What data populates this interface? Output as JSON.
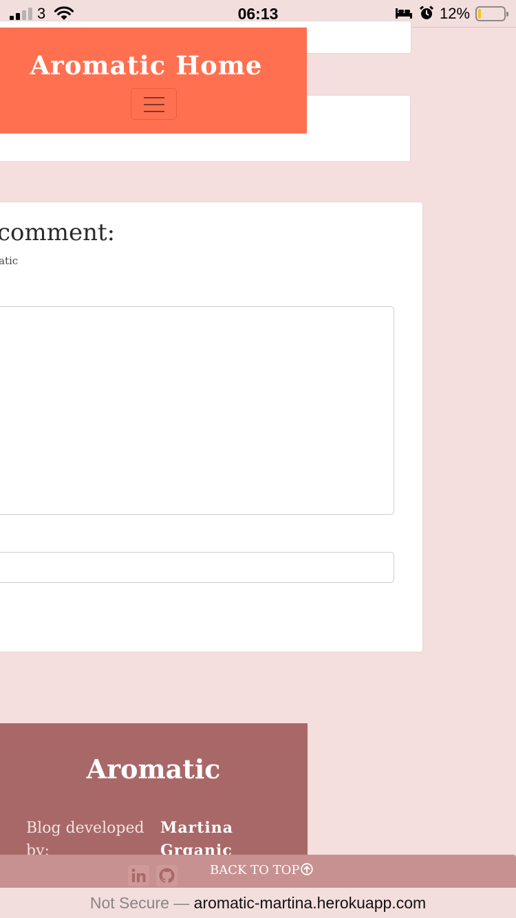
{
  "status_bar": {
    "carrier": "3",
    "time": "06:13",
    "battery_percent": "12%",
    "battery_level": 0.12,
    "icons": [
      "signal-icon",
      "wifi-icon",
      "bed-icon",
      "alarm-icon",
      "battery-icon"
    ]
  },
  "navbar": {
    "brand": "Aromatic Home",
    "background_color": "#ff7051",
    "toggler_icon": "hamburger-icon"
  },
  "comment_form": {
    "heading": "comment:",
    "subtext": "atic",
    "textarea_value": "",
    "input_value": ""
  },
  "footer": {
    "brand": "Aromatic",
    "developed_label": "Blog developed by:",
    "developer_name": "Martina Grganic",
    "background_color": "#a96868",
    "social_icons": [
      "linkedin-icon",
      "github-icon"
    ],
    "back_to_top": "BACK TO TOP"
  },
  "browser": {
    "security_label": "Not Secure —",
    "url": "aromatic-martina.herokuapp.com"
  },
  "colors": {
    "page_background": "#f5dede",
    "back_bar": "#c69190"
  }
}
